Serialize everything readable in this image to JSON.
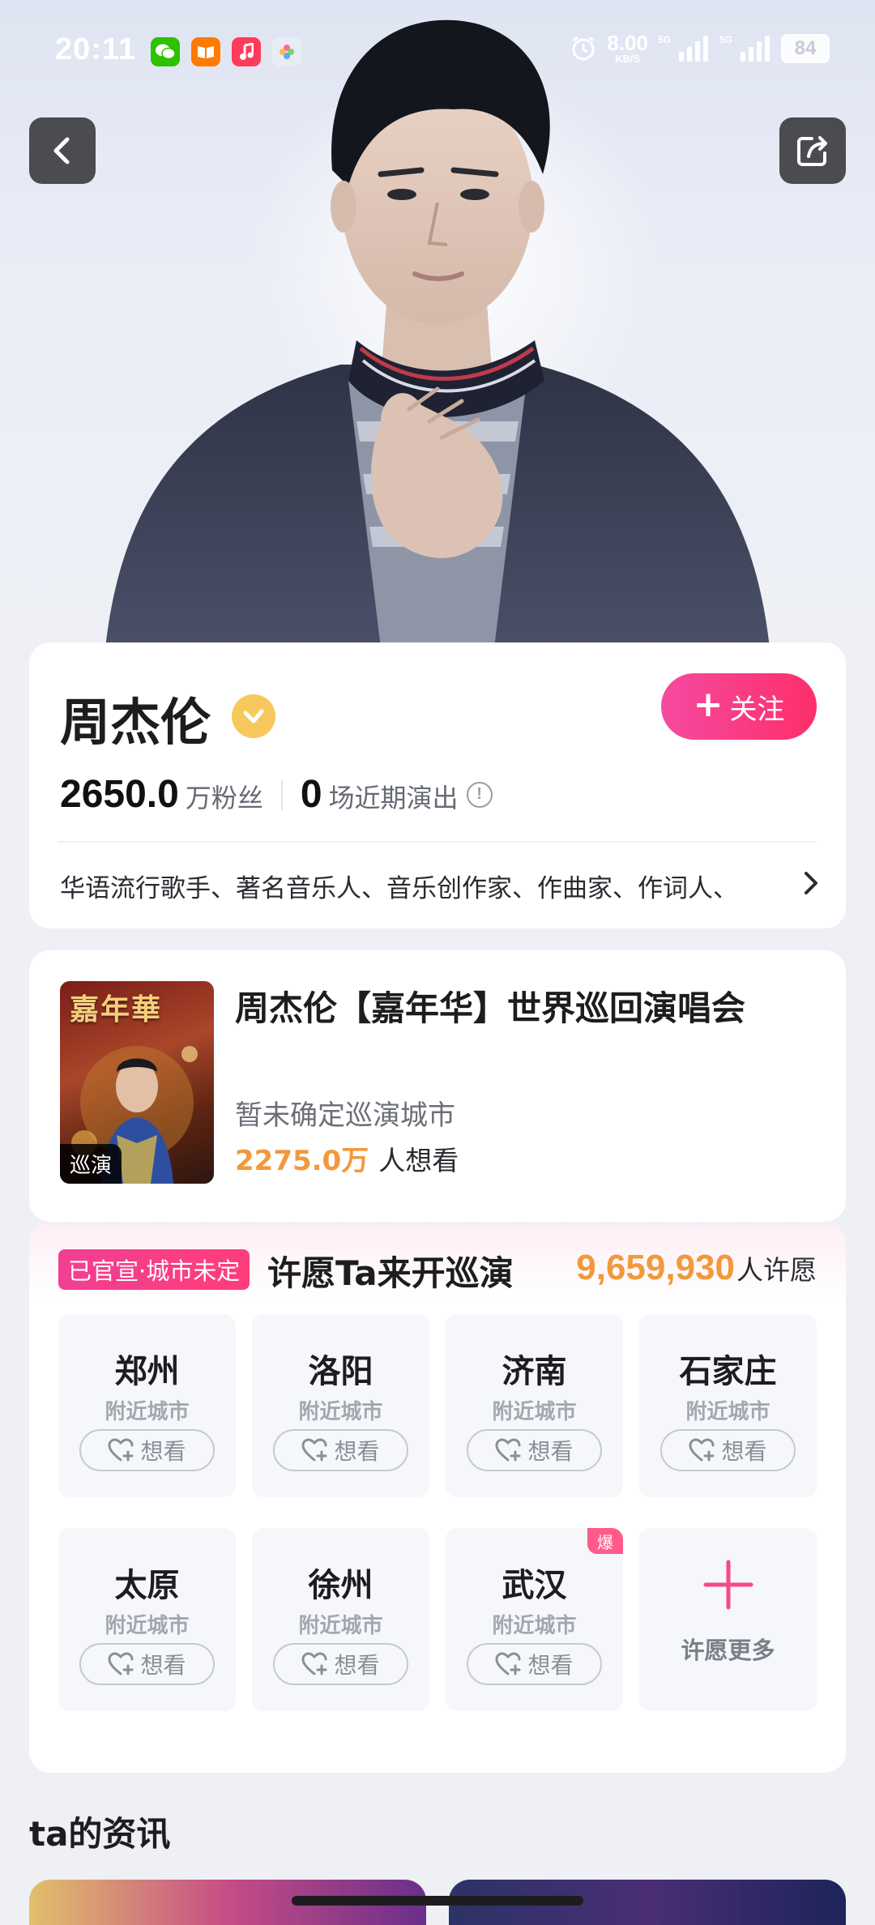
{
  "statusbar": {
    "time": "20:11",
    "apps": [
      {
        "name": "wechat-icon",
        "color": "#2dc100"
      },
      {
        "name": "reader-icon",
        "color": "#ff7a00"
      },
      {
        "name": "music-icon",
        "color": "#ff3b5c"
      },
      {
        "name": "photos-icon",
        "color": "#e8ecf5"
      }
    ],
    "net_speed": "8.00",
    "net_unit": "KB/S",
    "signal_1": "5G",
    "signal_2": "5G",
    "battery": "84"
  },
  "profile": {
    "name": "周杰伦",
    "follow_label": "关注",
    "fans_count": "2650.0",
    "fans_label": "万粉丝",
    "shows_count": "0",
    "shows_label": "场近期演出",
    "description": "华语流行歌手、著名音乐人、音乐创作家、作曲家、作词人、"
  },
  "concert": {
    "poster_title": "嘉年華",
    "poster_tag": "巡演",
    "title": "周杰伦【嘉年华】世界巡回演唱会",
    "city_status": "暂未确定巡演城市",
    "wants_count": "2275.0万",
    "wants_label": "人想看"
  },
  "wish": {
    "badge": "已官宣·城市未定",
    "title": "许愿Ta来开巡演",
    "count": "9,659,930",
    "count_label": "人许愿",
    "cities": [
      {
        "name": "郑州",
        "sub": "附近城市",
        "want": "想看"
      },
      {
        "name": "洛阳",
        "sub": "附近城市",
        "want": "想看"
      },
      {
        "name": "济南",
        "sub": "附近城市",
        "want": "想看"
      },
      {
        "name": "石家庄",
        "sub": "附近城市",
        "want": "想看"
      },
      {
        "name": "太原",
        "sub": "附近城市",
        "want": "想看"
      },
      {
        "name": "徐州",
        "sub": "附近城市",
        "want": "想看"
      },
      {
        "name": "武汉",
        "sub": "附近城市",
        "want": "想看",
        "hot": "爆"
      }
    ],
    "more_label": "许愿更多"
  },
  "news": {
    "title": "ta的资讯"
  },
  "colors": {
    "accent_pink": "#fd2f69",
    "accent_orange": "#f2993b",
    "verified_gold": "#f7c95c"
  }
}
